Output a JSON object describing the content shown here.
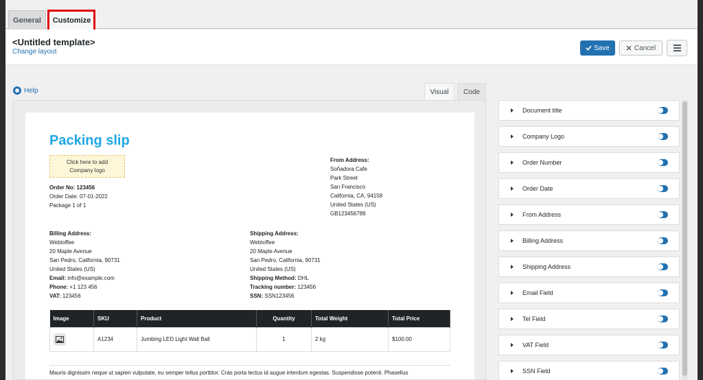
{
  "tabs": {
    "general": "General",
    "customize": "Customize"
  },
  "header": {
    "title": "<Untitled template>",
    "change_layout": "Change layout",
    "save": "Save",
    "cancel": "Cancel"
  },
  "help": "Help",
  "view_tabs": {
    "visual": "Visual",
    "code": "Code"
  },
  "document": {
    "title": "Packing slip",
    "logo_placeholder_line1": "Click here to add",
    "logo_placeholder_line2": "Company logo",
    "order_no": "Order No: 123456",
    "order_date": "Order Date: 07-01-2022",
    "package": "Package 1 of 1",
    "from": {
      "heading": "From Address:",
      "lines": [
        "Soñadora Cafe",
        "Park Street",
        "San Francisco",
        "California, CA, 94158",
        "United States (US)",
        "GB123456789"
      ]
    },
    "billing": {
      "heading": "Billing Address:",
      "lines": [
        "Webtoffee",
        "20 Maple Avenue",
        "San Pedro, California, 90731",
        "United States (US)"
      ],
      "email_label": "Email:",
      "email": "info@example.com",
      "phone_label": "Phone:",
      "phone": "+1 123 456",
      "vat_label": "VAT:",
      "vat": "123456"
    },
    "shipping": {
      "heading": "Shipping Address:",
      "lines": [
        "Webtoffee",
        "20 Maple Avenue",
        "San Pedro, California, 90731",
        "United States (US)"
      ],
      "method_label": "Shipping Method:",
      "method": "DHL",
      "tracking_label": "Tracking number:",
      "tracking": "123456",
      "ssn_label": "SSN:",
      "ssn": "SSN123456"
    },
    "table": {
      "headers": [
        "Image",
        "SKU",
        "Product",
        "Quantity",
        "Total Weight",
        "Total Price"
      ],
      "row": {
        "sku": "A1234",
        "product": "Jumbing LED Light Wall Ball",
        "quantity": "1",
        "weight": "2 kg",
        "price": "$100.00"
      }
    },
    "footer": "Mauris dignissim neque ut sapien vulputate, eu semper tellus porttitor. Cras porta lectus id augue interdum egestas. Suspendisse potenti. Phasellus"
  },
  "side_items": [
    "Document title",
    "Company Logo",
    "Order Number",
    "Order Date",
    "From Address",
    "Billing Address",
    "Shipping Address",
    "Email Field",
    "Tel Field",
    "VAT Field",
    "SSN Field"
  ],
  "colors": {
    "accent": "#2271b1",
    "title": "#1ea7e5",
    "highlight": "#e00000"
  }
}
